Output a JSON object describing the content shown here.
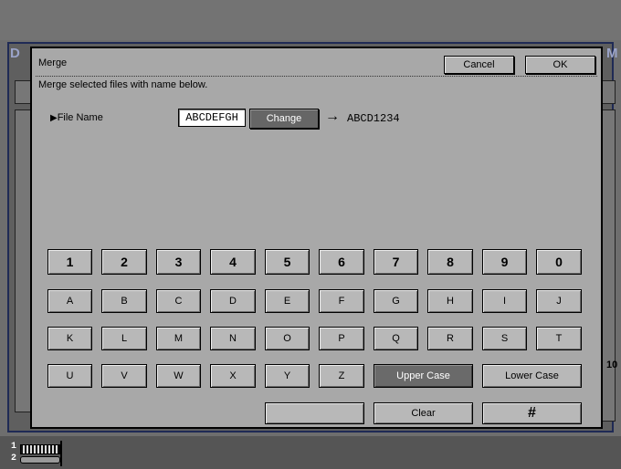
{
  "background": {
    "left_letter": "D",
    "right_letter": "M",
    "side_number": "10"
  },
  "dialog": {
    "title": "Merge",
    "cancel_label": "Cancel",
    "ok_label": "OK",
    "instruction": "Merge selected files with name below.",
    "file_name_label": "File Name",
    "file_name_value": "ABCDEFGH",
    "change_label": "Change",
    "arrow": "→",
    "new_name": "ABCD1234"
  },
  "keypad": {
    "numbers": [
      "1",
      "2",
      "3",
      "4",
      "5",
      "6",
      "7",
      "8",
      "9",
      "0"
    ],
    "row_a": [
      "A",
      "B",
      "C",
      "D",
      "E",
      "F",
      "G",
      "H",
      "I",
      "J"
    ],
    "row_k": [
      "K",
      "L",
      "M",
      "N",
      "O",
      "P",
      "Q",
      "R",
      "S",
      "T"
    ],
    "row_u": [
      "U",
      "V",
      "W",
      "X",
      "Y",
      "Z"
    ],
    "upper_case_label": "Upper Case",
    "lower_case_label": "Lower Case",
    "space_label": "",
    "clear_label": "Clear",
    "hash_label": "#",
    "active_mode": "upper"
  },
  "status": {
    "line1": "1",
    "line2": "2"
  },
  "colors": {
    "dialog_bg": "#a8a8a8",
    "key_bg": "#b8b8b8",
    "active_key_bg": "#6a6a6a",
    "frame_border": "#1f2a55"
  }
}
